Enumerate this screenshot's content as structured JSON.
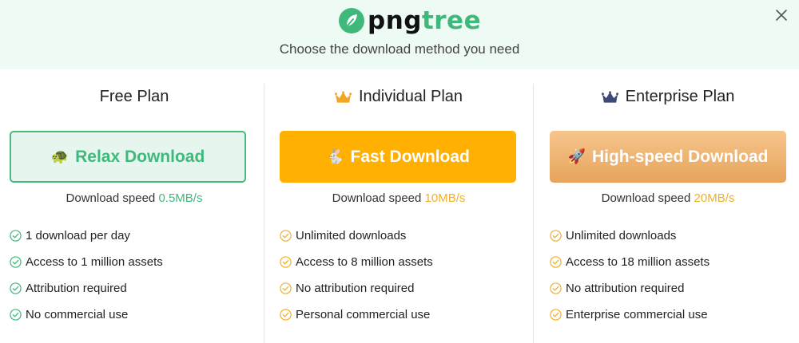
{
  "header": {
    "logo": {
      "text_part1": "png",
      "text_part2": "tree",
      "icon": "pngtree-leaf-logo-icon"
    },
    "subtitle": "Choose the download method you need",
    "close_icon": "close-icon"
  },
  "colors": {
    "header_bg": "#eefaf4",
    "free_accent": "#3fb97b",
    "individual_accent": "#ffb000",
    "enterprise_accent": "#e7a45c",
    "crown_individual": "#f5a524",
    "crown_enterprise": "#3c4a7a"
  },
  "plans": [
    {
      "title": "Free Plan",
      "button": {
        "icon": "🐢",
        "label": "Relax Download"
      },
      "speed_label": "Download speed",
      "speed_value": "0.5MB/s",
      "features": [
        "1 download per day",
        "Access to 1 million assets",
        "Attribution required",
        "No commercial use"
      ]
    },
    {
      "title": "Individual Plan",
      "title_icon": "crown-icon",
      "button": {
        "icon": "🐇",
        "label": "Fast Download"
      },
      "speed_label": "Download speed",
      "speed_value": "10MB/s",
      "features": [
        "Unlimited downloads",
        "Access to 8 million assets",
        "No attribution required",
        "Personal commercial use"
      ]
    },
    {
      "title": "Enterprise Plan",
      "title_icon": "crown-icon",
      "button": {
        "icon": "🚀",
        "label": "High-speed Download"
      },
      "speed_label": "Download speed",
      "speed_value": "20MB/s",
      "features": [
        "Unlimited downloads",
        "Access to 18 million assets",
        "No attribution required",
        "Enterprise commercial use"
      ]
    }
  ]
}
